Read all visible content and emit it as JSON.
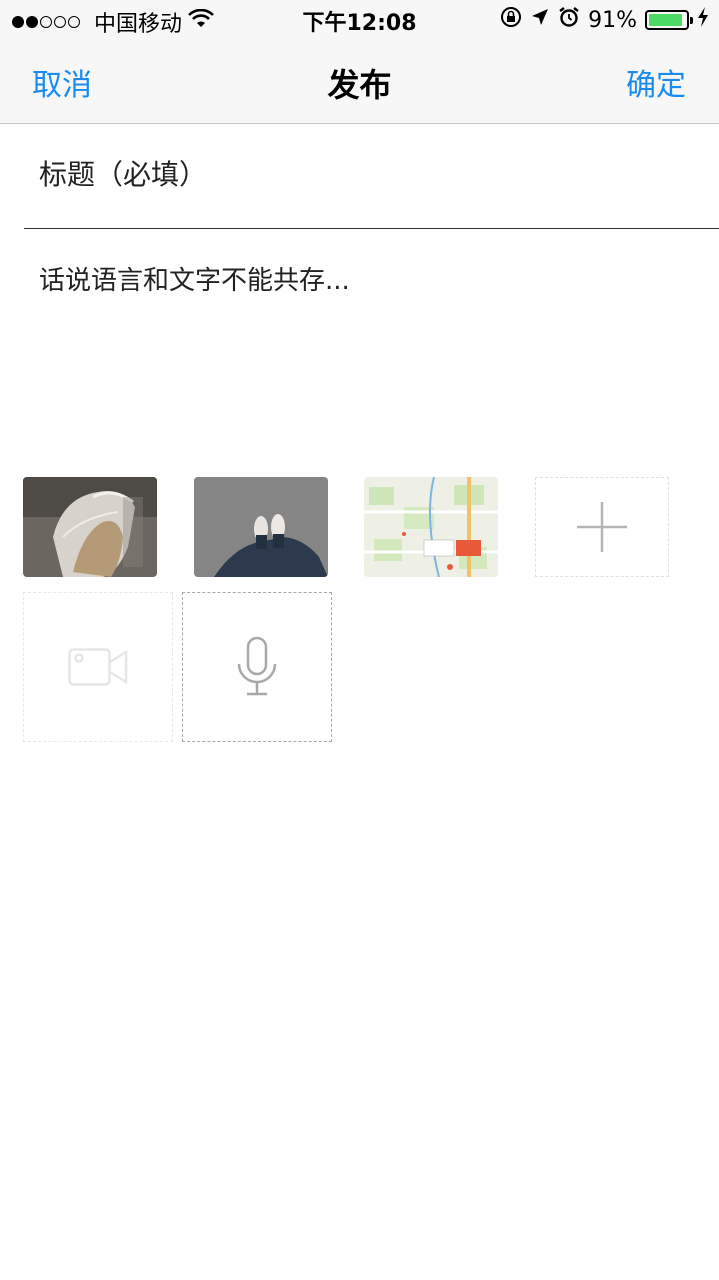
{
  "status_bar": {
    "carrier": "中国移动",
    "time": "下午12:08",
    "battery": "91%",
    "battery_level": 0.91,
    "battery_color": "#4cd964"
  },
  "nav": {
    "cancel": "取消",
    "title": "发布",
    "confirm": "确定",
    "accent_color": "#1a8cf0"
  },
  "form": {
    "title_placeholder": "标题（必填）",
    "body_placeholder": "话说语言和文字不能共存..."
  },
  "attachments": {
    "photos": [
      {
        "icon": "photo-plastic-bag"
      },
      {
        "icon": "photo-shoes-on-pavement"
      },
      {
        "icon": "photo-map-screenshot"
      }
    ],
    "add_photo_icon": "plus-icon",
    "video_icon": "video-camera-icon",
    "audio_icon": "microphone-icon"
  }
}
